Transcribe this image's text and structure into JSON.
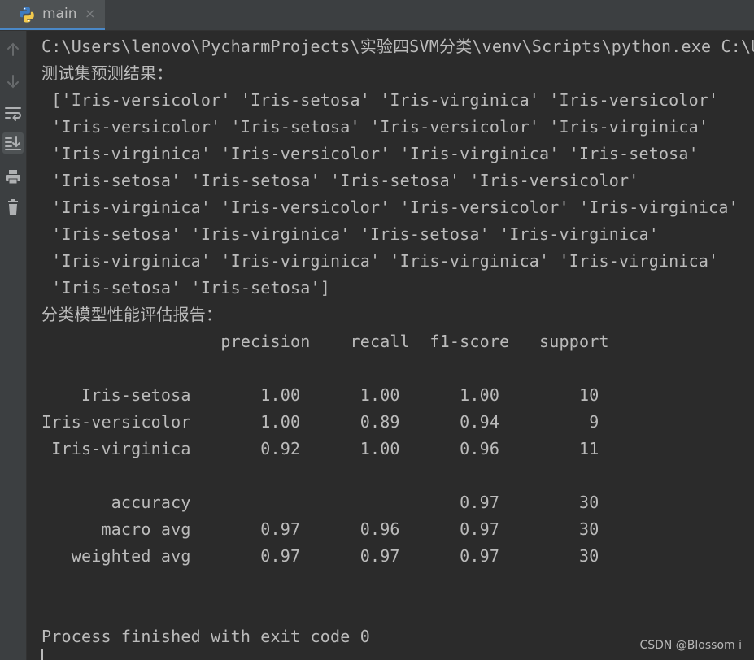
{
  "tab": {
    "label": "main",
    "close": "×",
    "icon": "python-icon"
  },
  "toolbar": {
    "items": [
      {
        "icon": "arrow-up-icon"
      },
      {
        "icon": "arrow-down-icon"
      },
      {
        "icon": "soft-wrap-icon"
      },
      {
        "icon": "scroll-to-end-icon"
      },
      {
        "icon": "print-icon"
      },
      {
        "icon": "trash-icon"
      }
    ]
  },
  "console": {
    "lines": [
      "C:\\Users\\lenovo\\PycharmProjects\\实验四SVM分类\\venv\\Scripts\\python.exe C:\\Us",
      "测试集预测结果：",
      " ['Iris-versicolor' 'Iris-setosa' 'Iris-virginica' 'Iris-versicolor'",
      " 'Iris-versicolor' 'Iris-setosa' 'Iris-versicolor' 'Iris-virginica'",
      " 'Iris-virginica' 'Iris-versicolor' 'Iris-virginica' 'Iris-setosa'",
      " 'Iris-setosa' 'Iris-setosa' 'Iris-setosa' 'Iris-versicolor'",
      " 'Iris-virginica' 'Iris-versicolor' 'Iris-versicolor' 'Iris-virginica'",
      " 'Iris-setosa' 'Iris-virginica' 'Iris-setosa' 'Iris-virginica'",
      " 'Iris-virginica' 'Iris-virginica' 'Iris-virginica' 'Iris-virginica'",
      " 'Iris-setosa' 'Iris-setosa']",
      "分类模型性能评估报告：",
      "                  precision    recall  f1-score   support",
      "",
      "    Iris-setosa       1.00      1.00      1.00        10",
      "Iris-versicolor       1.00      0.89      0.94         9",
      " Iris-virginica       0.92      1.00      0.96        11",
      "",
      "       accuracy                           0.97        30",
      "      macro avg       0.97      0.96      0.97        30",
      "   weighted avg       0.97      0.97      0.97        30",
      "",
      "",
      "Process finished with exit code 0"
    ]
  },
  "watermark": "CSDN @Blossom i",
  "colors": {
    "background": "#2b2b2b",
    "text": "#bbbbbb",
    "tab_underline": "#4a88c7"
  }
}
